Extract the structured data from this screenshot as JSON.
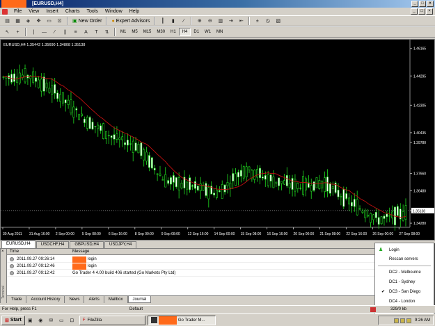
{
  "window": {
    "title": "[EURUSD,H4]"
  },
  "menu": [
    "File",
    "View",
    "Insert",
    "Charts",
    "Tools",
    "Window",
    "Help"
  ],
  "toolbar1": {
    "new_order": "New Order",
    "expert_advisors": "Expert Advisors"
  },
  "timeframes": [
    "M1",
    "M5",
    "M15",
    "M30",
    "H1",
    "H4",
    "D1",
    "W1",
    "MN"
  ],
  "selected_timeframe": "H4",
  "chart": {
    "header": "EURUSD,H4  1.35442 1.35690 1.34808 1.35138",
    "current_price": "1.35138",
    "price_labels": [
      "1.46165",
      "1.44295",
      "1.42305",
      "1.40435",
      "1.39780",
      "1.37660",
      "1.36480",
      "1.35138",
      "1.34280"
    ],
    "date_labels": [
      "30 Aug 2011",
      "31 Aug 16:00",
      "2 Sep 00:00",
      "5 Sep 08:00",
      "6 Sep 16:00",
      "8 Sep 00:00",
      "9 Sep 08:00",
      "12 Sep 16:00",
      "14 Sep 00:00",
      "15 Sep 08:00",
      "16 Sep 16:00",
      "20 Sep 00:00",
      "21 Sep 08:00",
      "22 Sep 16:00",
      "26 Sep 00:00",
      "27 Sep 08:00"
    ],
    "ma_color": "#c01010",
    "candle_color": "#20e020"
  },
  "chart_data": {
    "type": "line",
    "title": "EURUSD,H4",
    "x": [
      "30 Aug 2011",
      "31 Aug 16:00",
      "2 Sep 00:00",
      "5 Sep 08:00",
      "6 Sep 16:00",
      "8 Sep 00:00",
      "9 Sep 08:00",
      "12 Sep 16:00",
      "14 Sep 00:00",
      "15 Sep 08:00",
      "16 Sep 16:00",
      "20 Sep 00:00",
      "21 Sep 08:00",
      "22 Sep 16:00",
      "26 Sep 00:00",
      "27 Sep 08:00"
    ],
    "series": [
      {
        "values": [
          1.442,
          1.443,
          1.431,
          1.414,
          1.402,
          1.395,
          1.372,
          1.368,
          1.363,
          1.38,
          1.372,
          1.368,
          1.37,
          1.356,
          1.345,
          1.35
        ]
      }
    ],
    "ylim": [
      1.34,
      1.462
    ]
  },
  "symbol_tabs": [
    "EURUSD,H4",
    "USDCHF,H4",
    "GBPUSD,H4",
    "USDJPY,H4"
  ],
  "terminal": {
    "col_time": "Time",
    "col_message": "Message",
    "rows": [
      {
        "time": "2011.09.27 09:26:14",
        "message": "login"
      },
      {
        "time": "2011.09.27 09:12:46",
        "message": "login"
      },
      {
        "time": "2011.09.27 09:12:42",
        "message": "Go Trader 4 4.00 build 406 started (Go Markets Pty Ltd)"
      }
    ],
    "tabs": [
      "Trade",
      "Account History",
      "News",
      "Alerts",
      "Mailbox",
      "Journal"
    ],
    "selected_tab": "Journal",
    "side_label": "Terminal"
  },
  "popup": {
    "login": "Login",
    "rescan": "Rescan servers",
    "servers": [
      "DC2 - Melbourne",
      "DC1 - Sydney",
      "DC3 - San Diego",
      "DC4 - London"
    ],
    "checked": "DC3 - San Diego"
  },
  "status": {
    "help": "For Help, press F1",
    "profile": "Default",
    "traffic": "329/0 kb"
  },
  "taskbar": {
    "start": "Start",
    "filezilla": "FileZilla",
    "gotrader": "Go Trader M...",
    "clock": "9:26 AM"
  }
}
